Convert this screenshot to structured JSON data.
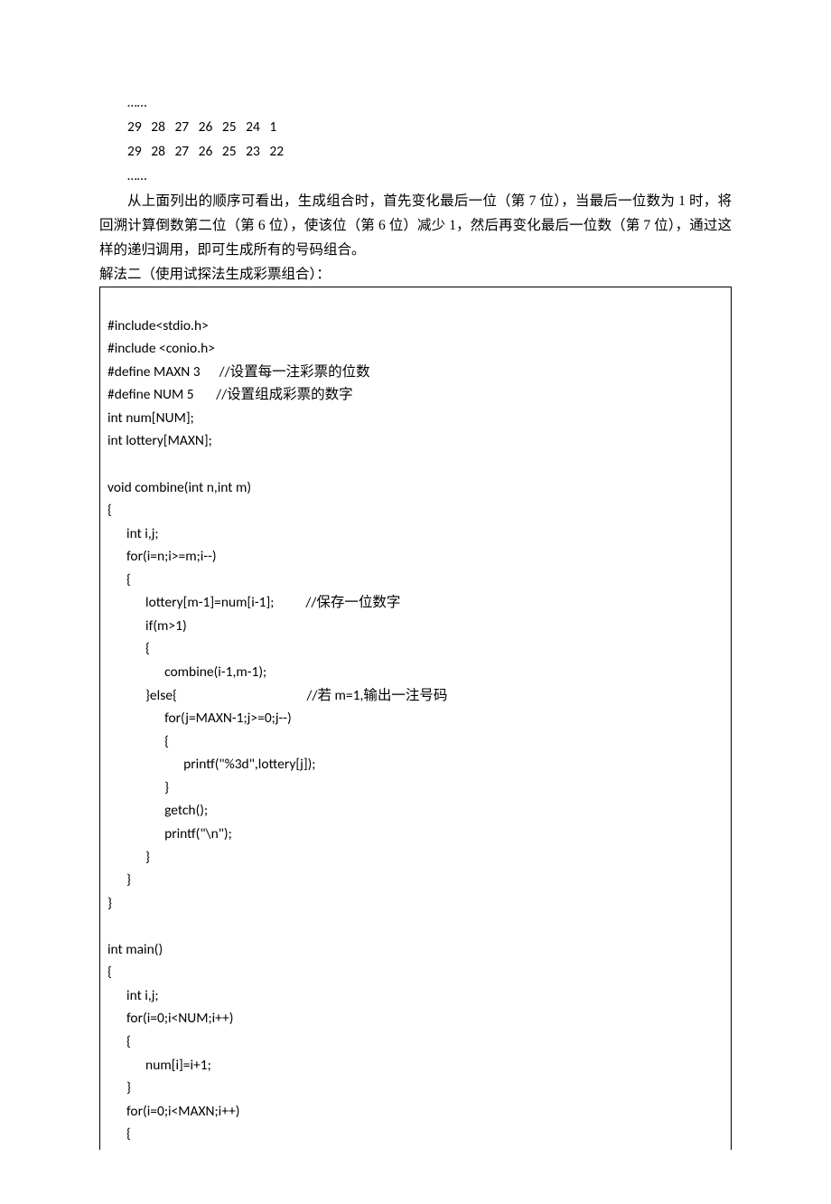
{
  "top": {
    "ellipsis1": "……",
    "row1": "29   28   27   26   25   24   1",
    "row2": "29   28   27   26   25   23   22",
    "ellipsis2": "……"
  },
  "para": "从上面列出的顺序可看出，生成组合时，首先变化最后一位（第 7 位），当最后一位数为 1 时，将回溯计算倒数第二位（第 6 位），使该位（第 6 位）减少 1，然后再变化最后一位数（第 7 位），通过这样的递归调用，即可生成所有的号码组合。",
  "soln_label": "解法二（使用试探法生成彩票组合）：",
  "code": {
    "l01": "#include<stdio.h>",
    "l02": "#include <conio.h>",
    "l03": "#define MAXN 3      //设置每一注彩票的位数",
    "l04": "#define NUM 5       //设置组成彩票的数字",
    "l05": "int num[NUM];",
    "l06": "int lottery[MAXN];",
    "l07": "",
    "l08": "void combine(int n,int m)",
    "l09": "{",
    "l10": "      int i,j;",
    "l11": "      for(i=n;i>=m;i--)",
    "l12": "      {",
    "l13": "            lottery[m-1]=num[i-1];          //保存一位数字",
    "l14": "            if(m>1)",
    "l15": "            {",
    "l16": "                  combine(i-1,m-1);",
    "l17": "            }else{                                         //若 m=1,输出一注号码",
    "l18": "                  for(j=MAXN-1;j>=0;j--)",
    "l19": "                  {",
    "l20": "                        printf(\"%3d\",lottery[j]);",
    "l21": "                  }",
    "l22": "                  getch();",
    "l23": "                  printf(\"\\n\");",
    "l24": "            }",
    "l25": "      }",
    "l26": "}",
    "l27": "",
    "l28": "int main()",
    "l29": "{",
    "l30": "      int i,j;",
    "l31": "      for(i=0;i<NUM;i++)",
    "l32": "      {",
    "l33": "            num[i]=i+1;",
    "l34": "      }",
    "l35": "      for(i=0;i<MAXN;i++)",
    "l36": "      {"
  }
}
